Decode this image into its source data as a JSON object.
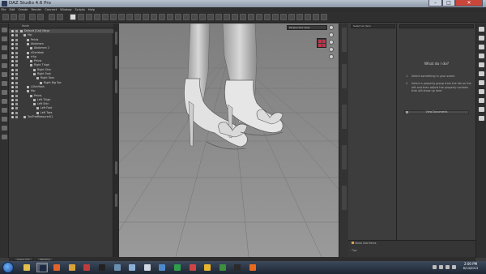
{
  "window": {
    "title": "DAZ Studio 4.6 Pro"
  },
  "menu": [
    "File",
    "Edit",
    "Create",
    "Render",
    "Connect",
    "Window",
    "Scripts",
    "Help"
  ],
  "scene": {
    "header_label": "Node",
    "nodes": [
      {
        "label": "Default (Cat) Maya",
        "depth": 0
      },
      {
        "label": "Hip",
        "depth": 1
      },
      {
        "label": "Pelvis",
        "depth": 2
      },
      {
        "label": "Abdomen",
        "depth": 2
      },
      {
        "label": "Abdomen 2",
        "depth": 3
      },
      {
        "label": "rShinYeah",
        "depth": 2
      },
      {
        "label": "rHip",
        "depth": 2
      },
      {
        "label": "Pelvis",
        "depth": 3
      },
      {
        "label": "Right Thigh",
        "depth": 3
      },
      {
        "label": "Right Shin",
        "depth": 4
      },
      {
        "label": "Right Foot",
        "depth": 4
      },
      {
        "label": "Right Toes",
        "depth": 5
      },
      {
        "label": "Right Big Toe",
        "depth": 6
      },
      {
        "label": "LShinYeah",
        "depth": 2
      },
      {
        "label": "Hip",
        "depth": 2
      },
      {
        "label": "Pelvis",
        "depth": 3
      },
      {
        "label": "Left Thigh",
        "depth": 4
      },
      {
        "label": "Left Shin",
        "depth": 4
      },
      {
        "label": "Left Foot",
        "depth": 5
      },
      {
        "label": "Left Toes",
        "depth": 5
      },
      {
        "label": "TooTheMeasurer01",
        "depth": 1
      }
    ]
  },
  "viewport": {
    "camera": "Perspective View"
  },
  "parameters": {
    "select_placeholder": "Select an item",
    "title": "What do I do?",
    "hints": [
      {
        "num": "1.",
        "text": "Select something in your scene"
      },
      {
        "num": "2.",
        "text": "Select a property group from the list on the left and then adjust the property controls that will show up here"
      }
    ],
    "docs_button": "View Documents",
    "sub_items_label": "Show Sub Items",
    "tips_label": "Tips"
  },
  "bottom_tabs": [
    "Scene Info",
    "Tabletop"
  ],
  "taskbar": {
    "apps": [
      {
        "name": "folder-app",
        "color": "#e4c04a"
      },
      {
        "name": "daz-studio-app",
        "color": "#1c2a44",
        "active": true
      },
      {
        "name": "media-player-app",
        "color": "#e0632a"
      },
      {
        "name": "media-app",
        "color": "#d8a13a"
      },
      {
        "name": "puzzle-app",
        "color": "#c23b3b"
      },
      {
        "name": "file-app",
        "color": "#222222"
      },
      {
        "name": "image-app",
        "color": "#6a8fb0"
      },
      {
        "name": "tool-app",
        "color": "#8ab0d8"
      },
      {
        "name": "document-app",
        "color": "#cfd7e2"
      },
      {
        "name": "photo-app",
        "color": "#4e89c9"
      },
      {
        "name": "green-app",
        "color": "#2e9e4a"
      },
      {
        "name": "graphics-app",
        "color": "#cf4444"
      },
      {
        "name": "chrome-app",
        "color": "#e7b52e"
      },
      {
        "name": "spreadsheet-app",
        "color": "#3e8f3e"
      },
      {
        "name": "terminal-app",
        "color": "#2a2a2a"
      },
      {
        "name": "firefox-app",
        "color": "#e86a1e"
      }
    ],
    "time": "2:00 PM",
    "date": "8/14/2013"
  },
  "colors": {
    "viewport_bg": "#8a8a8a",
    "accent": "#d9a54a",
    "close": "#c9463a"
  }
}
